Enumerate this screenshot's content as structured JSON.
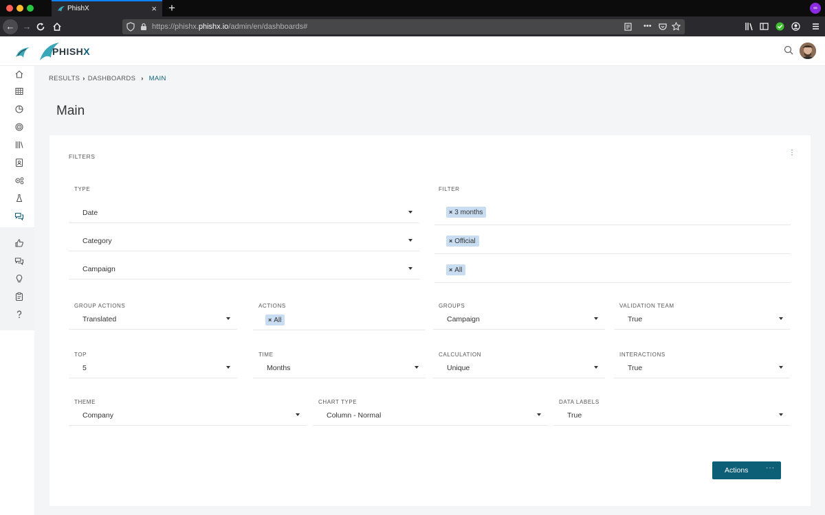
{
  "browser": {
    "tab_title": "PhishX",
    "tab_close": "×",
    "new_tab": "+",
    "url_prefix": "https://phishx.",
    "url_domain": "phishx.io",
    "url_path": "/admin/en/dashboards#",
    "url_more": "•••"
  },
  "header": {
    "logo_text_a": "PHISH",
    "logo_text_b": "X"
  },
  "breadcrumb": {
    "items": [
      "RESULTS",
      "DASHBOARDS",
      "MAIN"
    ],
    "separator": "›"
  },
  "page": {
    "title": "Main"
  },
  "filters": {
    "title": "FILTERS",
    "kebab": "⋮",
    "type_label": "TYPE",
    "filter_label": "FILTER",
    "rows": [
      {
        "type": "Date",
        "chip": "3 months"
      },
      {
        "type": "Category",
        "chip": "Official"
      },
      {
        "type": "Campaign",
        "chip": "All"
      }
    ],
    "chip_x": "×",
    "group_actions": {
      "label": "GROUP ACTIONS",
      "value": "Translated"
    },
    "actions": {
      "label": "ACTIONS",
      "chip": "All"
    },
    "groups": {
      "label": "GROUPS",
      "value": "Campaign"
    },
    "validation_team": {
      "label": "VALIDATION TEAM",
      "value": "True"
    },
    "top": {
      "label": "TOP",
      "value": "5"
    },
    "time": {
      "label": "TIME",
      "value": "Months"
    },
    "calculation": {
      "label": "CALCULATION",
      "value": "Unique"
    },
    "interactions": {
      "label": "INTERACTIONS",
      "value": "True"
    },
    "theme": {
      "label": "THEME",
      "value": "Company"
    },
    "chart_type": {
      "label": "CHART TYPE",
      "value": "Column - Normal"
    },
    "data_labels": {
      "label": "DATA LABELS",
      "value": "True"
    }
  },
  "actions_button": {
    "label": "Actions",
    "more": "···"
  },
  "colors": {
    "primary": "#0d5e77",
    "chip_bg": "#c9ddf2",
    "browser_accent": "#0a84ff"
  }
}
